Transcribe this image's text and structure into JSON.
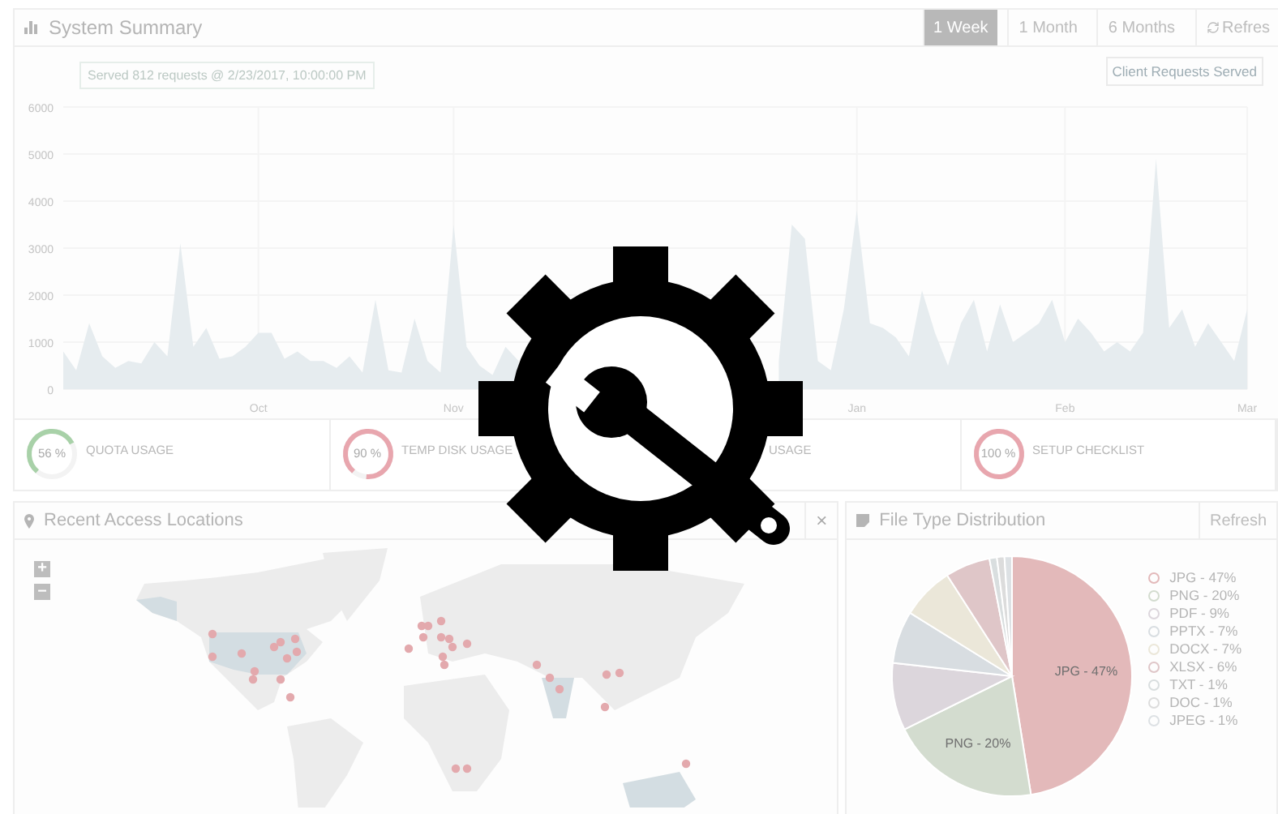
{
  "summary": {
    "title": "System Summary",
    "ranges": [
      {
        "label": "1 Week",
        "selected": true
      },
      {
        "label": "1 Month",
        "selected": false
      },
      {
        "label": "6 Months",
        "selected": false
      }
    ],
    "refresh": "Refres",
    "tooltip": "Served 812 requests @ 2/23/2017, 10:00:00 PM",
    "chart_data": {
      "type": "area",
      "grid": true,
      "ylim": [
        0,
        6000
      ],
      "yticks": [
        0,
        1000,
        2000,
        3000,
        4000,
        5000,
        6000
      ],
      "categories": [
        null,
        null,
        null,
        null,
        null,
        null,
        null,
        null,
        null,
        null,
        null,
        null,
        null,
        null,
        null,
        "Oct",
        null,
        null,
        null,
        null,
        null,
        null,
        null,
        null,
        null,
        null,
        null,
        null,
        null,
        null,
        "Nov",
        null,
        null,
        null,
        null,
        null,
        null,
        null,
        null,
        null,
        null,
        null,
        null,
        null,
        null,
        null,
        null,
        null,
        null,
        null,
        null,
        null,
        null,
        null,
        null,
        null,
        null,
        null,
        null,
        null,
        null,
        "Jan",
        null,
        null,
        null,
        null,
        null,
        null,
        null,
        null,
        null,
        null,
        null,
        null,
        null,
        null,
        null,
        "Feb",
        null,
        null,
        null,
        null,
        null,
        null,
        null,
        null,
        null,
        null,
        null,
        null,
        null,
        "Mar"
      ],
      "series": [
        {
          "name": "Client Requests Served",
          "color": "#e6ecef",
          "values": [
            800,
            400,
            1400,
            700,
            450,
            600,
            550,
            1000,
            700,
            3100,
            900,
            1300,
            650,
            700,
            900,
            1200,
            1200,
            650,
            800,
            600,
            600,
            450,
            700,
            350,
            1900,
            400,
            350,
            1500,
            600,
            350,
            3500,
            900,
            500,
            300,
            900,
            600,
            null,
            null,
            null,
            null,
            null,
            null,
            null,
            null,
            null,
            null,
            null,
            null,
            null,
            null,
            null,
            null,
            null,
            null,
            null,
            600,
            3500,
            3200,
            600,
            400,
            1700,
            3800,
            1400,
            1300,
            1100,
            700,
            2100,
            1200,
            500,
            1400,
            1900,
            800,
            1800,
            1000,
            1200,
            1400,
            1900,
            1000,
            1500,
            1200,
            800,
            1000,
            800,
            1200,
            4900,
            1300,
            1700,
            900,
            1400,
            1000,
            600,
            1700
          ]
        }
      ]
    }
  },
  "gauges": [
    {
      "value": "56 %",
      "label": "QUOTA USAGE",
      "level": 0.56,
      "color": "#a8d1a8"
    },
    {
      "value": "90 %",
      "label": "TEMP DISK USAGE",
      "level": 0.9,
      "color": "#e8a6ae"
    },
    {
      "label": "USAGE"
    },
    {
      "value": "100 %",
      "label": "SETUP CHECKLIST",
      "level": 1,
      "color": "#e8a6ae"
    }
  ],
  "locations": {
    "title": "Recent Access Locations",
    "close": "×",
    "zoom_in": "+",
    "zoom_out": "–"
  },
  "file_types": {
    "title": "File Type Distribution",
    "refresh": "Refresh",
    "slice_labels": [
      "JPG - 47%",
      "PNG - 20%"
    ],
    "chart_data": {
      "type": "pie",
      "categories": [
        "JPG - 47%",
        "PNG - 20%",
        "PDF - 9%",
        "PPTX - 7%",
        "DOCX - 7%",
        "XLSX - 6%",
        "TXT - 1%",
        "DOC - 1%",
        "JPEG - 1%"
      ],
      "values": [
        47,
        20,
        9,
        7,
        7,
        6,
        1,
        1,
        1
      ],
      "colors": [
        "#e3b9ba",
        "#d3dccf",
        "#dcd6dc",
        "#d8dde1",
        "#ebe7d9",
        "#dfc6c8",
        "#d9dedf",
        "#dcdcdc",
        "#dde1e4"
      ]
    }
  }
}
